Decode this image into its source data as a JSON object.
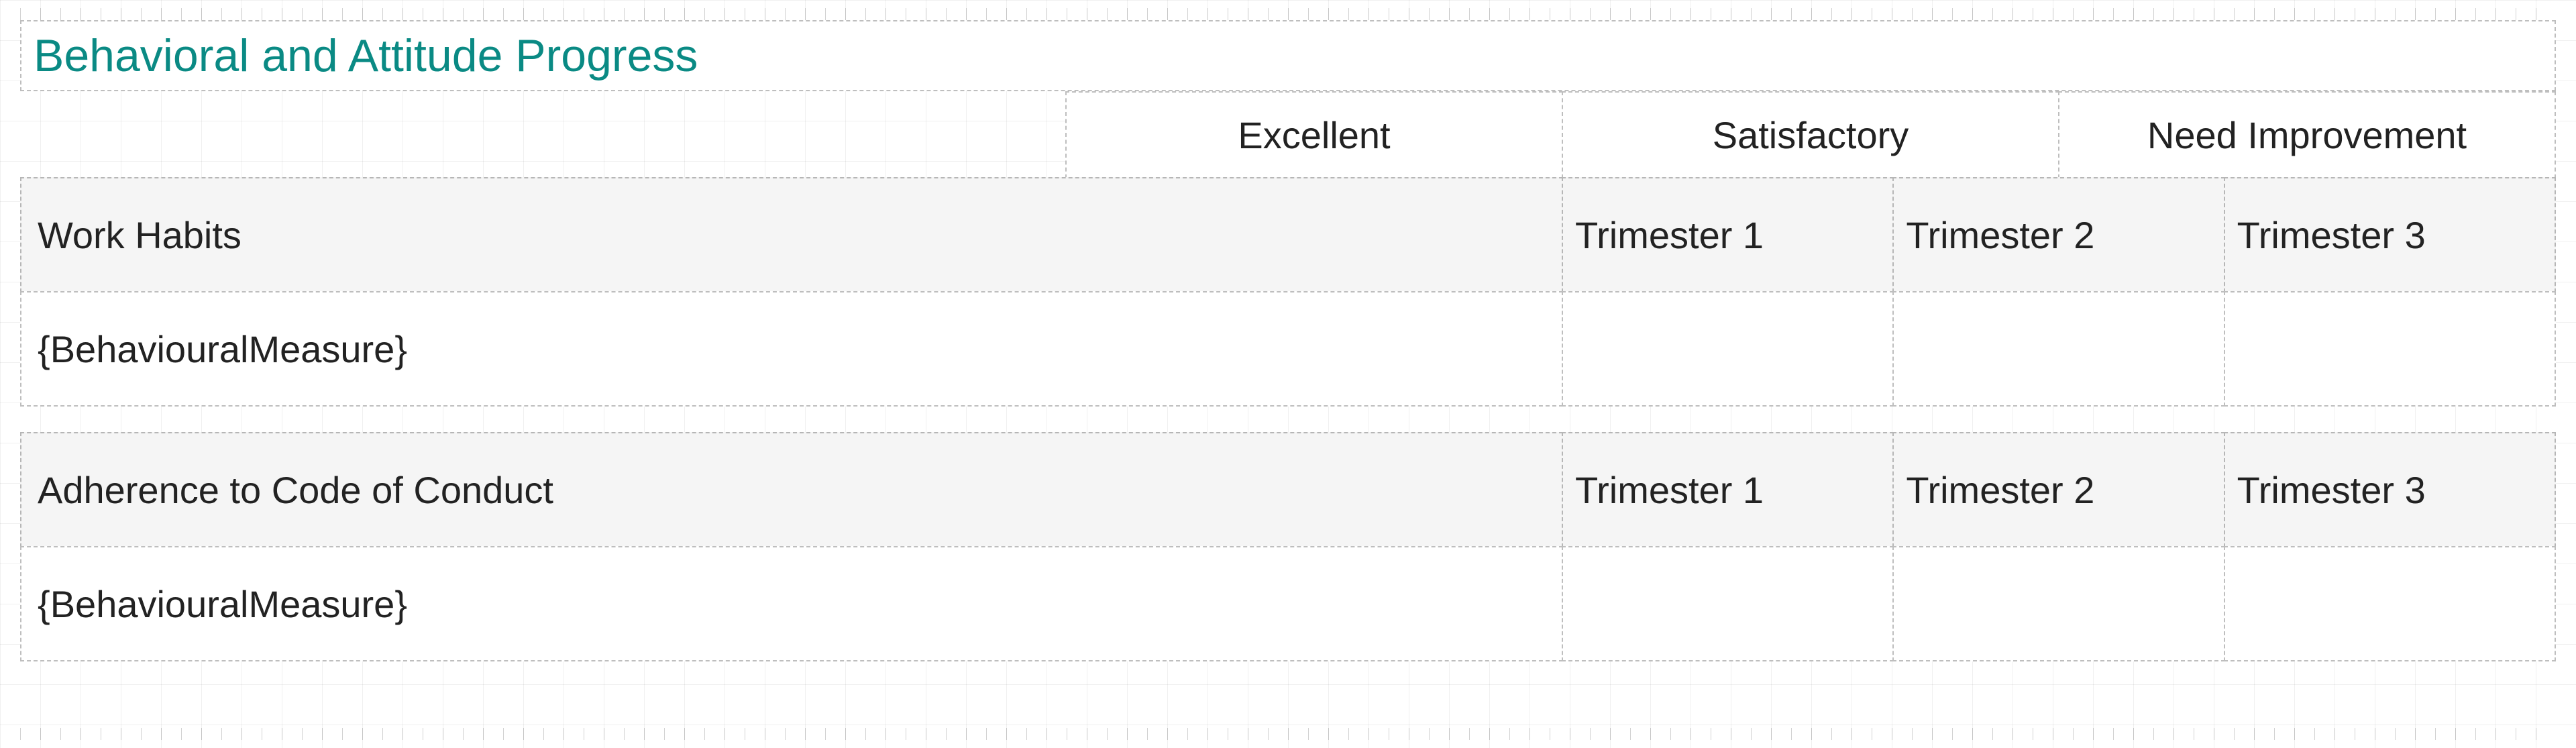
{
  "title": "Behavioral and Attitude Progress",
  "ratings": {
    "excellent": "Excellent",
    "satisfactory": "Satisfactory",
    "need_improvement": "Need Improvement"
  },
  "sections": [
    {
      "label": "Work Habits",
      "trimesters": {
        "t1": "Trimester 1",
        "t2": "Trimester 2",
        "t3": "Trimester 3"
      },
      "measure_placeholder": "{BehaviouralMeasure}"
    },
    {
      "label": "Adherence to Code of Conduct",
      "trimesters": {
        "t1": "Trimester 1",
        "t2": "Trimester 2",
        "t3": "Trimester 3"
      },
      "measure_placeholder": "{BehaviouralMeasure}"
    }
  ]
}
